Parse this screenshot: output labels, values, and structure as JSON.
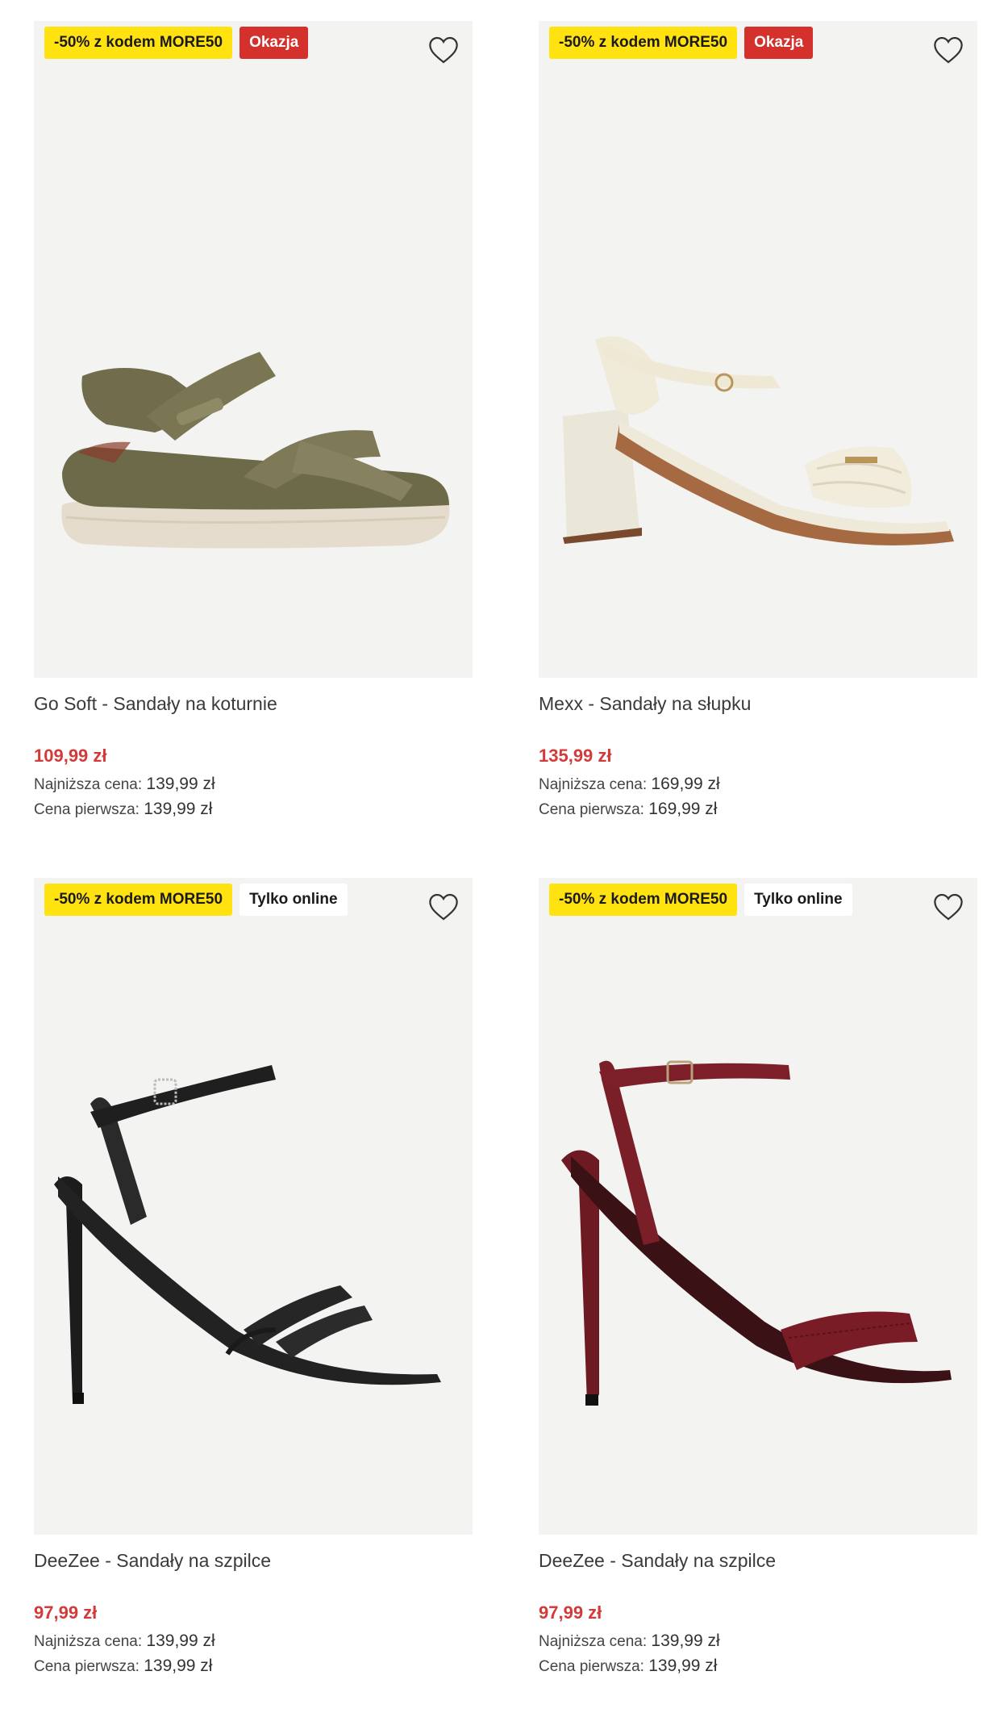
{
  "products": [
    {
      "title": "Go Soft - Sandały na koturnie",
      "promo_badge": "-50% z kodem MORE50",
      "second_badge": "Okazja",
      "price": "109,99 zł",
      "lowest_label": "Najniższa cena:",
      "lowest_value": "139,99 zł",
      "first_label": "Cena pierwsza:",
      "first_value": "139,99 zł",
      "image": "olive-wedge-sandal"
    },
    {
      "title": "Mexx - Sandały na słupku",
      "promo_badge": "-50% z kodem MORE50",
      "second_badge": "Okazja",
      "price": "135,99 zł",
      "lowest_label": "Najniższa cena:",
      "lowest_value": "169,99 zł",
      "first_label": "Cena pierwsza:",
      "first_value": "169,99 zł",
      "image": "cream-block-heel-sandal"
    },
    {
      "title": "DeeZee - Sandały na szpilce",
      "promo_badge": "-50% z kodem MORE50",
      "second_badge": "Tylko online",
      "price": "97,99 zł",
      "lowest_label": "Najniższa cena:",
      "lowest_value": "139,99 zł",
      "first_label": "Cena pierwsza:",
      "first_value": "139,99 zł",
      "image": "black-stiletto-sandal"
    },
    {
      "title": "DeeZee - Sandały na szpilce",
      "promo_badge": "-50% z kodem MORE50",
      "second_badge": "Tylko online",
      "price": "97,99 zł",
      "lowest_label": "Najniższa cena:",
      "lowest_value": "139,99 zł",
      "first_label": "Cena pierwsza:",
      "first_value": "139,99 zł",
      "image": "burgundy-stiletto-sandal"
    }
  ],
  "icons": {
    "wishlist": "heart-outline-icon"
  },
  "colors": {
    "promo_badge_bg": "#ffe20f",
    "sale_badge_bg": "#d4302c",
    "price": "#d33a3a",
    "image_bg": "#f3f3f2"
  }
}
